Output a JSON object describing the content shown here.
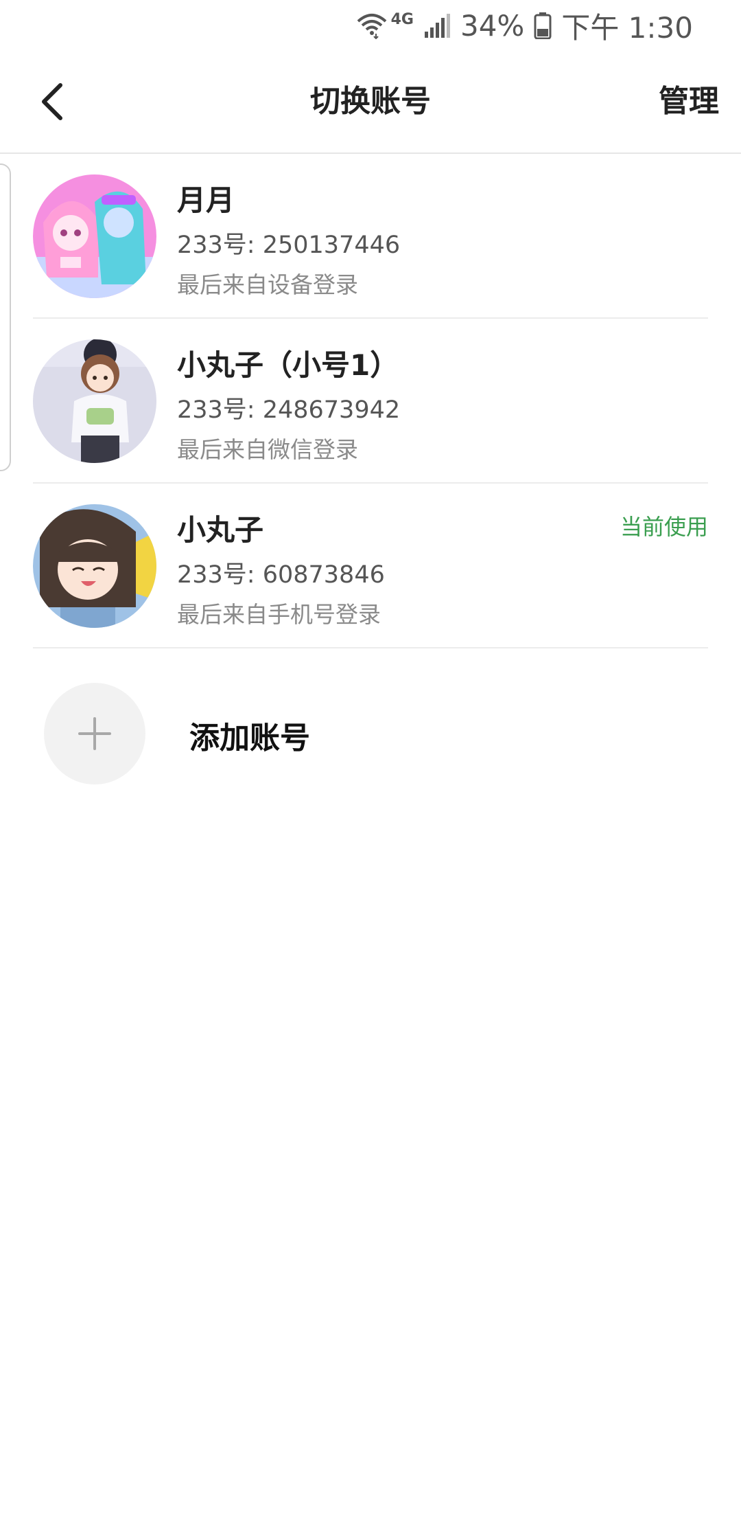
{
  "status_bar": {
    "network": "4G",
    "battery": "34%",
    "time": "下午 1:30",
    "icons": [
      "wifi-icon",
      "signal-icon",
      "battery-icon"
    ]
  },
  "nav": {
    "back_icon": "chevron-left-icon",
    "title": "切换账号",
    "manage_label": "管理"
  },
  "accounts": [
    {
      "name": "月月",
      "id_text": "233号: 250137446",
      "login_text": "最后来自设备登录",
      "current_label": ""
    },
    {
      "name": "小丸子（小号1）",
      "id_text": "233号: 248673942",
      "login_text": "最后来自微信登录",
      "current_label": ""
    },
    {
      "name": "小丸子",
      "id_text": "233号: 60873846",
      "login_text": "最后来自手机号登录",
      "current_label": "当前使用"
    }
  ],
  "add_account": {
    "icon": "plus-icon",
    "label": "添加账号"
  },
  "colors": {
    "current_badge": "#3a9e4f",
    "divider": "#ececec",
    "secondary_text": "#555555",
    "tertiary_text": "#8a8a8a"
  }
}
